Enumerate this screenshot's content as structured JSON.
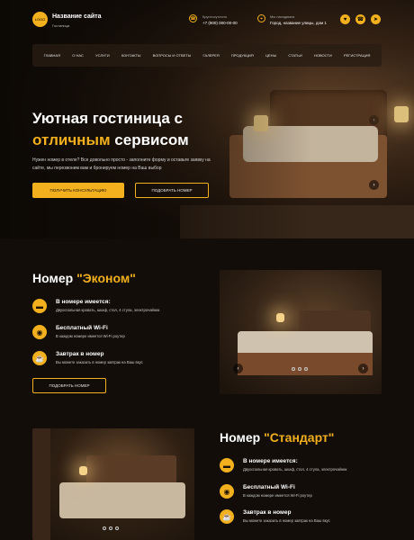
{
  "header": {
    "logo_text": "LOGO",
    "site_title": "Название сайта",
    "site_subtitle": "Гостиница",
    "phone_label": "Круглосуточно",
    "phone": "+7 (900) 000-00-00",
    "address_label": "Мы находимся",
    "address": "Город, название улицы, дом 1",
    "social": [
      "♥",
      "☎",
      "➤"
    ]
  },
  "nav": [
    "ГЛАВНАЯ",
    "О НАС",
    "УСЛУГИ",
    "КОНТАКТЫ",
    "ВОПРОСЫ И ОТВЕТЫ",
    "ГАЛЕРЕЯ",
    "ПРОДУКЦИЯ",
    "ЦЕНЫ",
    "СТАТЬИ",
    "НОВОСТИ",
    "РЕГИСТРАЦИЯ"
  ],
  "hero": {
    "title_line1": "Уютная гостиница с",
    "title_accent": "отличным",
    "title_rest": "сервисом",
    "description": "Нужен номер в отеле? Все довольно просто - заполните форму и оставьте заявку на сайте, мы перезвоним вам и бронируем номер на Ваш выбор",
    "btn_primary": "ПОЛУЧИТЬ КОНСУЛЬТАЦИЮ",
    "btn_secondary": "ПОДОБРАТЬ НОМЕР",
    "prev": "‹",
    "next": "›"
  },
  "econom": {
    "title_prefix": "Номер ",
    "title_accent": "\"Эконом\"",
    "features": [
      {
        "icon": "bed-icon",
        "glyph": "▬",
        "title": "В номере имеется:",
        "text": "Двухспальная кровать, шкаф, стол, 4 стула, электрочайник"
      },
      {
        "icon": "wifi-icon",
        "glyph": "◉",
        "title": "Бесплатный Wi-Fi",
        "text": "В каждом номере имеется Wi-Fi роутер"
      },
      {
        "icon": "breakfast-icon",
        "glyph": "☕",
        "title": "Завтрак в номер",
        "text": "Вы можете заказать в номер завтрак на Ваш вкус"
      }
    ],
    "button": "ПОДОБРАТЬ НОМЕР",
    "prev": "‹",
    "next": "›"
  },
  "standard": {
    "title_prefix": "Номер ",
    "title_accent": "\"Стандарт\"",
    "features": [
      {
        "icon": "bed-icon",
        "glyph": "▬",
        "title": "В номере имеется:",
        "text": "Двухспальная кровать, шкаф, стол, 4 стула, электрочайник"
      },
      {
        "icon": "wifi-icon",
        "glyph": "◉",
        "title": "Бесплатный Wi-Fi",
        "text": "В каждом номере имеется Wi-Fi роутер"
      },
      {
        "icon": "breakfast-icon",
        "glyph": "☕",
        "title": "Завтрак в номер",
        "text": "Вы можете заказать в номер завтрак на Ваш вкус"
      }
    ]
  },
  "colors": {
    "accent": "#f2b01e",
    "background": "#120d09"
  }
}
